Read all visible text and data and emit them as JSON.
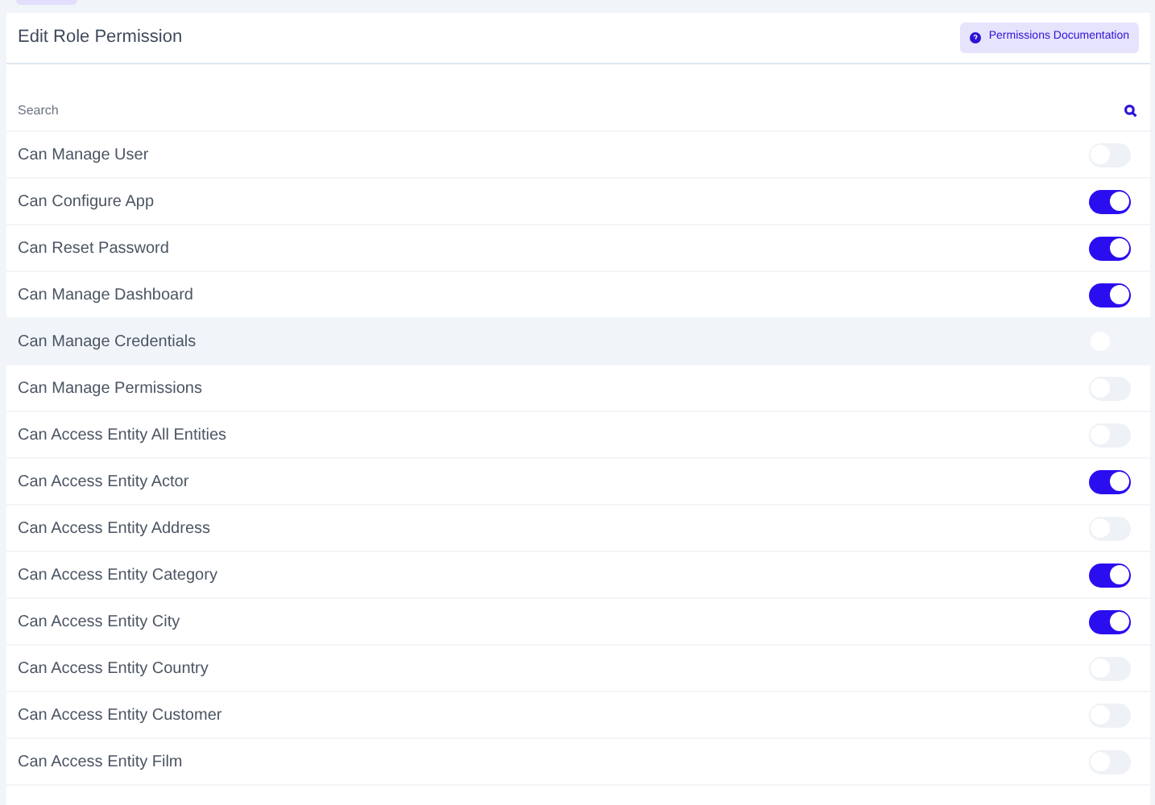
{
  "title": "Edit Role Permission",
  "doc_button": {
    "label": "Permissions Documentation"
  },
  "search": {
    "placeholder": "Search"
  },
  "permissions": [
    {
      "label": "Can Manage User",
      "on": false,
      "highlighted": false
    },
    {
      "label": "Can Configure App",
      "on": true,
      "highlighted": false
    },
    {
      "label": "Can Reset Password",
      "on": true,
      "highlighted": false
    },
    {
      "label": "Can Manage Dashboard",
      "on": true,
      "highlighted": false
    },
    {
      "label": "Can Manage Credentials",
      "on": false,
      "highlighted": true
    },
    {
      "label": "Can Manage Permissions",
      "on": false,
      "highlighted": false
    },
    {
      "label": "Can Access Entity All Entities",
      "on": false,
      "highlighted": false
    },
    {
      "label": "Can Access Entity Actor",
      "on": true,
      "highlighted": false
    },
    {
      "label": "Can Access Entity Address",
      "on": false,
      "highlighted": false
    },
    {
      "label": "Can Access Entity Category",
      "on": true,
      "highlighted": false
    },
    {
      "label": "Can Access Entity City",
      "on": true,
      "highlighted": false
    },
    {
      "label": "Can Access Entity Country",
      "on": false,
      "highlighted": false
    },
    {
      "label": "Can Access Entity Customer",
      "on": false,
      "highlighted": false
    },
    {
      "label": "Can Access Entity Film",
      "on": false,
      "highlighted": false
    }
  ]
}
